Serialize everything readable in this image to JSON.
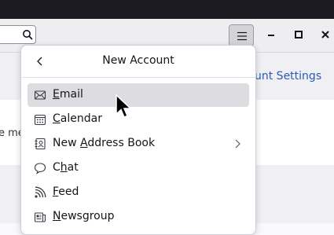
{
  "background": {
    "right_link": "unt Settings",
    "left_text": "e me"
  },
  "panel": {
    "title": "New Account",
    "items": [
      {
        "pre": "",
        "key": "E",
        "post": "mail",
        "icon": "envelope-icon"
      },
      {
        "pre": "",
        "key": "C",
        "post": "alendar",
        "icon": "calendar-icon"
      },
      {
        "pre": "New ",
        "key": "A",
        "post": "ddress Book",
        "icon": "address-book-icon"
      },
      {
        "pre": "C",
        "key": "h",
        "post": "at",
        "icon": "chat-icon"
      },
      {
        "pre": "",
        "key": "F",
        "post": "eed",
        "icon": "rss-feed-icon"
      },
      {
        "pre": "",
        "key": "N",
        "post": "ewsgroup",
        "icon": "newsgroup-icon"
      }
    ]
  },
  "colors": {
    "hover_bg": "#dddde1",
    "link": "#2a5ab8"
  }
}
